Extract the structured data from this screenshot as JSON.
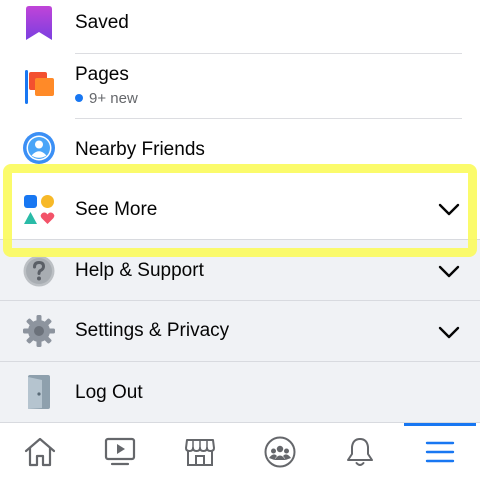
{
  "menu": {
    "saved": {
      "label": "Saved",
      "icon": "bookmark-icon"
    },
    "pages": {
      "label": "Pages",
      "badge": "9+ new",
      "icon": "flag-icon"
    },
    "nearby_friends": {
      "label": "Nearby Friends",
      "icon": "nearby-friends-icon"
    },
    "see_more": {
      "label": "See More",
      "icon": "shapes-icon",
      "highlighted": true
    },
    "help_support": {
      "label": "Help & Support",
      "icon": "question-icon"
    },
    "settings_privacy": {
      "label": "Settings & Privacy",
      "icon": "gear-icon"
    },
    "log_out": {
      "label": "Log Out",
      "icon": "door-icon"
    }
  },
  "tabbar": {
    "tabs": [
      {
        "name": "home",
        "icon": "home-icon"
      },
      {
        "name": "watch",
        "icon": "video-icon"
      },
      {
        "name": "marketplace",
        "icon": "store-icon"
      },
      {
        "name": "groups",
        "icon": "groups-icon"
      },
      {
        "name": "notifications",
        "icon": "bell-icon"
      },
      {
        "name": "menu",
        "icon": "hamburger-icon",
        "active": true
      }
    ]
  },
  "colors": {
    "accent": "#1877f2",
    "highlight": "#fbfb5e",
    "section_gray": "#f0f2f5"
  }
}
